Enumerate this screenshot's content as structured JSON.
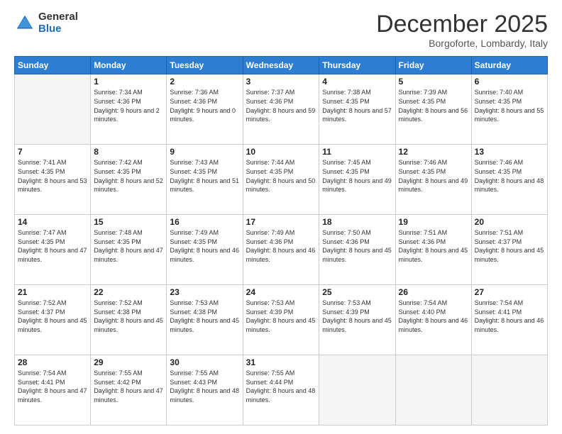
{
  "logo": {
    "general": "General",
    "blue": "Blue"
  },
  "header": {
    "month": "December 2025",
    "location": "Borgoforte, Lombardy, Italy"
  },
  "weekdays": [
    "Sunday",
    "Monday",
    "Tuesday",
    "Wednesday",
    "Thursday",
    "Friday",
    "Saturday"
  ],
  "weeks": [
    [
      {
        "day": "",
        "empty": true
      },
      {
        "day": "1",
        "sunrise": "Sunrise: 7:34 AM",
        "sunset": "Sunset: 4:36 PM",
        "daylight": "Daylight: 9 hours and 2 minutes."
      },
      {
        "day": "2",
        "sunrise": "Sunrise: 7:36 AM",
        "sunset": "Sunset: 4:36 PM",
        "daylight": "Daylight: 9 hours and 0 minutes."
      },
      {
        "day": "3",
        "sunrise": "Sunrise: 7:37 AM",
        "sunset": "Sunset: 4:36 PM",
        "daylight": "Daylight: 8 hours and 59 minutes."
      },
      {
        "day": "4",
        "sunrise": "Sunrise: 7:38 AM",
        "sunset": "Sunset: 4:35 PM",
        "daylight": "Daylight: 8 hours and 57 minutes."
      },
      {
        "day": "5",
        "sunrise": "Sunrise: 7:39 AM",
        "sunset": "Sunset: 4:35 PM",
        "daylight": "Daylight: 8 hours and 56 minutes."
      },
      {
        "day": "6",
        "sunrise": "Sunrise: 7:40 AM",
        "sunset": "Sunset: 4:35 PM",
        "daylight": "Daylight: 8 hours and 55 minutes."
      }
    ],
    [
      {
        "day": "7",
        "sunrise": "Sunrise: 7:41 AM",
        "sunset": "Sunset: 4:35 PM",
        "daylight": "Daylight: 8 hours and 53 minutes."
      },
      {
        "day": "8",
        "sunrise": "Sunrise: 7:42 AM",
        "sunset": "Sunset: 4:35 PM",
        "daylight": "Daylight: 8 hours and 52 minutes."
      },
      {
        "day": "9",
        "sunrise": "Sunrise: 7:43 AM",
        "sunset": "Sunset: 4:35 PM",
        "daylight": "Daylight: 8 hours and 51 minutes."
      },
      {
        "day": "10",
        "sunrise": "Sunrise: 7:44 AM",
        "sunset": "Sunset: 4:35 PM",
        "daylight": "Daylight: 8 hours and 50 minutes."
      },
      {
        "day": "11",
        "sunrise": "Sunrise: 7:45 AM",
        "sunset": "Sunset: 4:35 PM",
        "daylight": "Daylight: 8 hours and 49 minutes."
      },
      {
        "day": "12",
        "sunrise": "Sunrise: 7:46 AM",
        "sunset": "Sunset: 4:35 PM",
        "daylight": "Daylight: 8 hours and 49 minutes."
      },
      {
        "day": "13",
        "sunrise": "Sunrise: 7:46 AM",
        "sunset": "Sunset: 4:35 PM",
        "daylight": "Daylight: 8 hours and 48 minutes."
      }
    ],
    [
      {
        "day": "14",
        "sunrise": "Sunrise: 7:47 AM",
        "sunset": "Sunset: 4:35 PM",
        "daylight": "Daylight: 8 hours and 47 minutes."
      },
      {
        "day": "15",
        "sunrise": "Sunrise: 7:48 AM",
        "sunset": "Sunset: 4:35 PM",
        "daylight": "Daylight: 8 hours and 47 minutes."
      },
      {
        "day": "16",
        "sunrise": "Sunrise: 7:49 AM",
        "sunset": "Sunset: 4:35 PM",
        "daylight": "Daylight: 8 hours and 46 minutes."
      },
      {
        "day": "17",
        "sunrise": "Sunrise: 7:49 AM",
        "sunset": "Sunset: 4:36 PM",
        "daylight": "Daylight: 8 hours and 46 minutes."
      },
      {
        "day": "18",
        "sunrise": "Sunrise: 7:50 AM",
        "sunset": "Sunset: 4:36 PM",
        "daylight": "Daylight: 8 hours and 45 minutes."
      },
      {
        "day": "19",
        "sunrise": "Sunrise: 7:51 AM",
        "sunset": "Sunset: 4:36 PM",
        "daylight": "Daylight: 8 hours and 45 minutes."
      },
      {
        "day": "20",
        "sunrise": "Sunrise: 7:51 AM",
        "sunset": "Sunset: 4:37 PM",
        "daylight": "Daylight: 8 hours and 45 minutes."
      }
    ],
    [
      {
        "day": "21",
        "sunrise": "Sunrise: 7:52 AM",
        "sunset": "Sunset: 4:37 PM",
        "daylight": "Daylight: 8 hours and 45 minutes."
      },
      {
        "day": "22",
        "sunrise": "Sunrise: 7:52 AM",
        "sunset": "Sunset: 4:38 PM",
        "daylight": "Daylight: 8 hours and 45 minutes."
      },
      {
        "day": "23",
        "sunrise": "Sunrise: 7:53 AM",
        "sunset": "Sunset: 4:38 PM",
        "daylight": "Daylight: 8 hours and 45 minutes."
      },
      {
        "day": "24",
        "sunrise": "Sunrise: 7:53 AM",
        "sunset": "Sunset: 4:39 PM",
        "daylight": "Daylight: 8 hours and 45 minutes."
      },
      {
        "day": "25",
        "sunrise": "Sunrise: 7:53 AM",
        "sunset": "Sunset: 4:39 PM",
        "daylight": "Daylight: 8 hours and 45 minutes."
      },
      {
        "day": "26",
        "sunrise": "Sunrise: 7:54 AM",
        "sunset": "Sunset: 4:40 PM",
        "daylight": "Daylight: 8 hours and 46 minutes."
      },
      {
        "day": "27",
        "sunrise": "Sunrise: 7:54 AM",
        "sunset": "Sunset: 4:41 PM",
        "daylight": "Daylight: 8 hours and 46 minutes."
      }
    ],
    [
      {
        "day": "28",
        "sunrise": "Sunrise: 7:54 AM",
        "sunset": "Sunset: 4:41 PM",
        "daylight": "Daylight: 8 hours and 47 minutes."
      },
      {
        "day": "29",
        "sunrise": "Sunrise: 7:55 AM",
        "sunset": "Sunset: 4:42 PM",
        "daylight": "Daylight: 8 hours and 47 minutes."
      },
      {
        "day": "30",
        "sunrise": "Sunrise: 7:55 AM",
        "sunset": "Sunset: 4:43 PM",
        "daylight": "Daylight: 8 hours and 48 minutes."
      },
      {
        "day": "31",
        "sunrise": "Sunrise: 7:55 AM",
        "sunset": "Sunset: 4:44 PM",
        "daylight": "Daylight: 8 hours and 48 minutes."
      },
      {
        "day": "",
        "empty": true
      },
      {
        "day": "",
        "empty": true
      },
      {
        "day": "",
        "empty": true
      }
    ]
  ]
}
